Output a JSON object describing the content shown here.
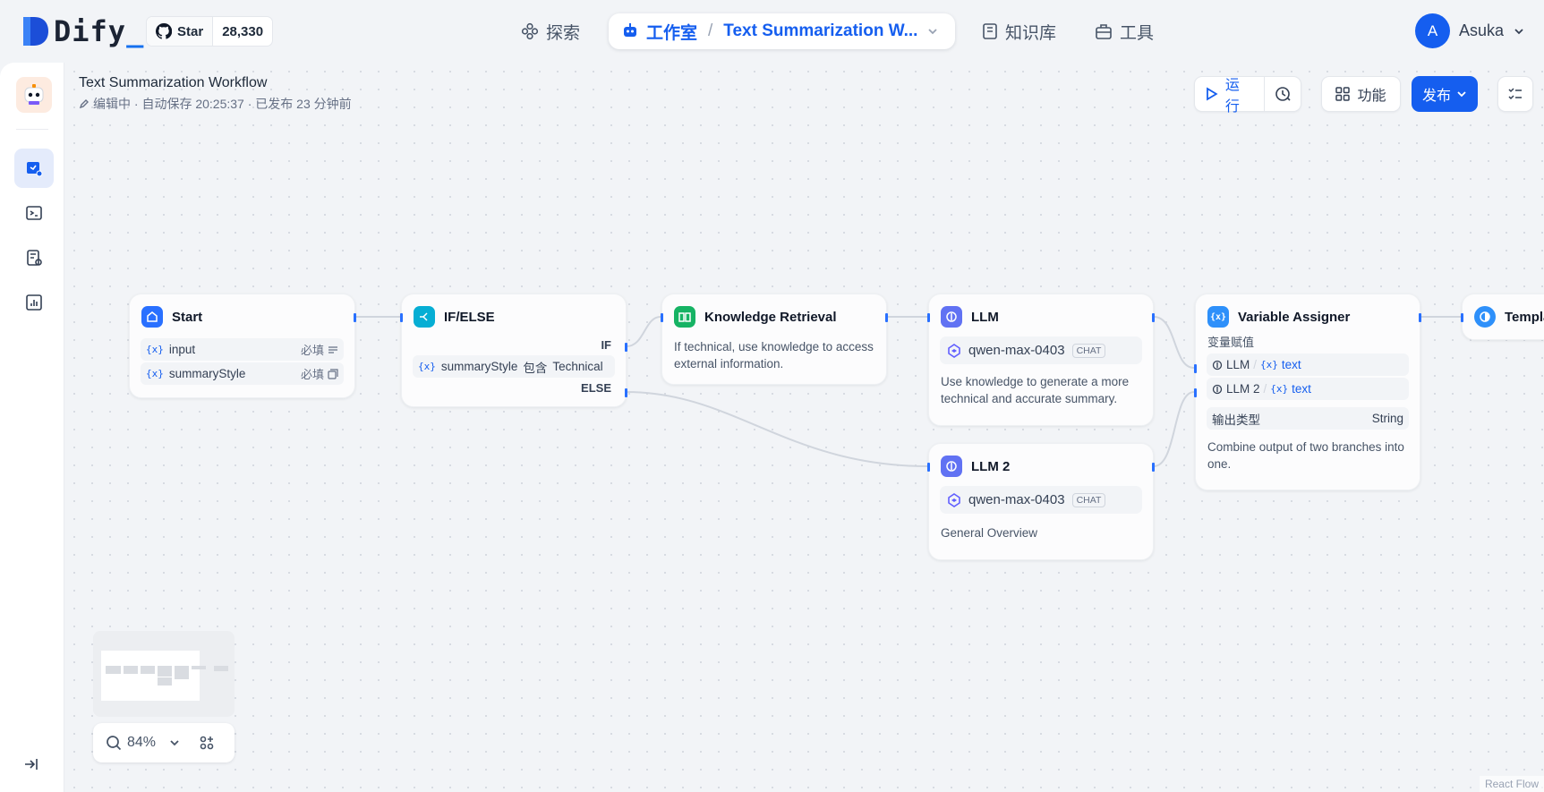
{
  "brand": {
    "name": "Dify",
    "cursor": "_"
  },
  "github": {
    "label": "Star",
    "count": "28,330"
  },
  "nav": {
    "explore": "探索",
    "studio": "工作室",
    "separator": "/",
    "app_name": "Text Summarization W...",
    "knowledge": "知识库",
    "tools": "工具"
  },
  "user": {
    "initial": "A",
    "name": "Asuka"
  },
  "workflow": {
    "title": "Text Summarization Workflow",
    "meta": "编辑中 · 自动保存 20:25:37 · 已发布 23 分钟前"
  },
  "toolbar": {
    "run": "运行",
    "features": "功能",
    "publish": "发布"
  },
  "nodes": {
    "start": {
      "title": "Start",
      "vars": [
        {
          "name": "input",
          "required": "必填"
        },
        {
          "name": "summaryStyle",
          "required": "必填"
        }
      ]
    },
    "ifelse": {
      "title": "IF/ELSE",
      "if_label": "IF",
      "else_label": "ELSE",
      "condition_var": "summaryStyle",
      "condition_op": "包含",
      "condition_value": "Technical"
    },
    "knowledge": {
      "title": "Knowledge Retrieval",
      "desc": "If technical, use knowledge to access external information."
    },
    "llm": {
      "title": "LLM",
      "model": "qwen-max-0403",
      "mode": "CHAT",
      "desc": "Use knowledge to generate a more technical and accurate summary."
    },
    "llm2": {
      "title": "LLM 2",
      "model": "qwen-max-0403",
      "mode": "CHAT",
      "desc": "General Overview"
    },
    "assigner": {
      "title": "Variable Assigner",
      "section_label": "变量赋值",
      "inputs": [
        {
          "node": "LLM",
          "var": "text"
        },
        {
          "node": "LLM 2",
          "var": "text"
        }
      ],
      "output_type_label": "输出类型",
      "output_type": "String",
      "desc": "Combine output of two branches into one."
    },
    "template": {
      "title": "Templa"
    }
  },
  "zoom": {
    "level": "84%"
  },
  "attribution": "React Flow",
  "colors": {
    "primary": "#155eef",
    "start_icon": "#2970ff",
    "ifelse_icon": "#06aed4",
    "knowledge_icon": "#16b364",
    "llm_icon": "#6172f3",
    "assigner_icon": "#2e90fa"
  }
}
